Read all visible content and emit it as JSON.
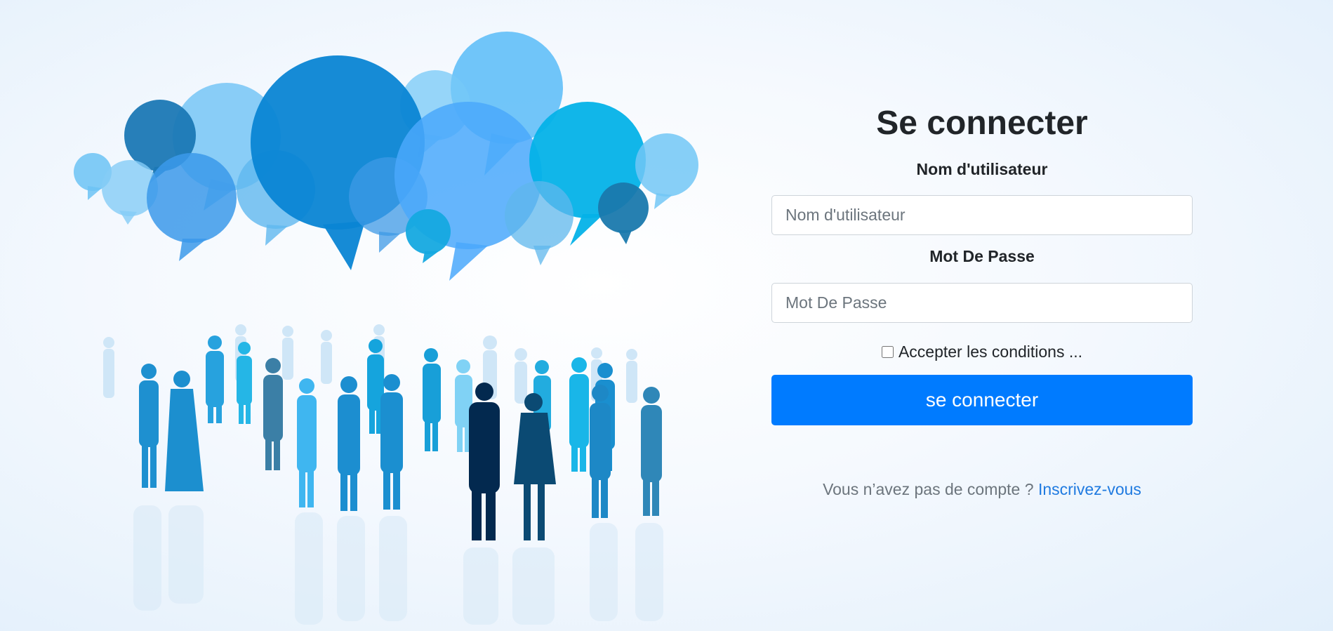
{
  "login": {
    "title": "Se connecter",
    "username_label": "Nom d'utilisateur",
    "username_placeholder": "Nom d'utilisateur",
    "username_value": "",
    "password_label": "Mot De Passe",
    "password_placeholder": "Mot De Passe",
    "password_value": "",
    "terms_label": "Accepter les conditions ...",
    "terms_checked": false,
    "submit_label": "se connecter",
    "signup_prompt": "Vous n’avez pas de compte  ? ",
    "signup_link": "Inscrivez-vous"
  },
  "illustration": {
    "description_icon": "speech-bubbles-and-crowd-illustration"
  },
  "colors": {
    "primary": "#007bff",
    "link": "#1f7ae0",
    "text": "#212529",
    "muted": "#6c757d",
    "input_border": "#ced4da"
  }
}
